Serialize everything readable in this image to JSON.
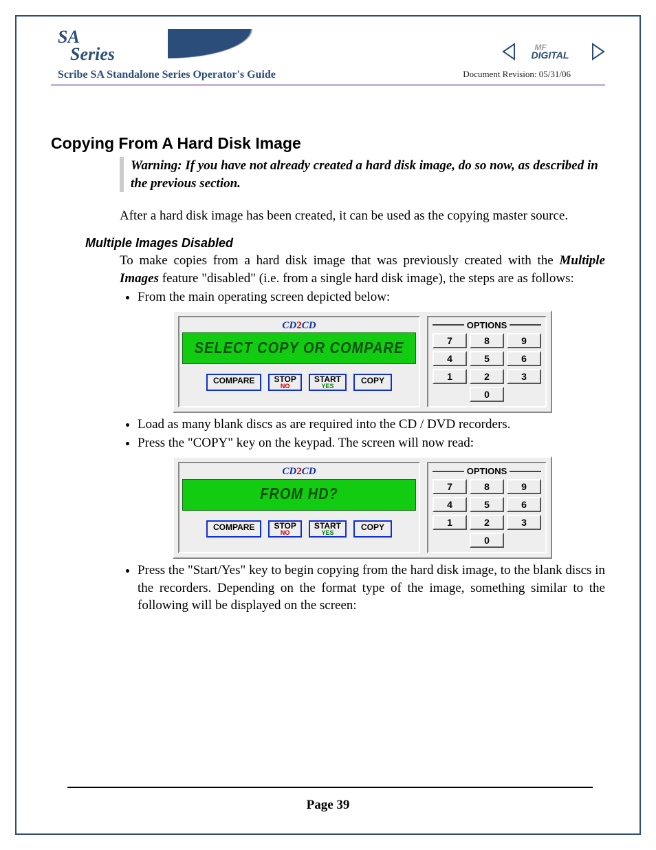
{
  "header": {
    "logo_line1": "SA",
    "logo_line2": "Series",
    "doc_title": "Scribe SA Standalone Series Operator's Guide",
    "doc_revision": "Document Revision: 05/31/06",
    "mf_logo_text": "MF DIGITAL"
  },
  "section": {
    "heading": "Copying From A Hard Disk Image",
    "warning": "Warning: If you have not already created a hard disk image, do so now, as described in the previous section.",
    "intro_para": "After a hard disk image has been created, it can be used as the copying master source.",
    "subheading": "Multiple Images Disabled",
    "sub_para_pre": "To make copies from a hard disk image that was previously created with the ",
    "sub_para_strong": "Multiple Images",
    "sub_para_post": " feature \"disabled\" (i.e. from a single hard disk image), the steps are as follows:",
    "bullet1": "From the main operating screen depicted below:",
    "bullet2": "Load as many blank discs as are required into the CD / DVD recorders.",
    "bullet3": "Press the \"COPY\" key on the keypad. The screen will now read:",
    "bullet4": "Press the \"Start/Yes\" key to begin copying from the hard disk image, to the blank discs in the recorders. Depending on the format type of the image, something similar to the following will be displayed on the screen:"
  },
  "panel": {
    "brand_cd": "CD",
    "brand_2": "2",
    "brand_cd2": "CD",
    "screen1_text": "SELECT COPY OR COMPARE",
    "screen2_text": "FROM HD?",
    "btn_compare": "COMPARE",
    "btn_stop": "STOP",
    "btn_stop_sub": "NO",
    "btn_start": "START",
    "btn_start_sub": "YES",
    "btn_copy": "COPY",
    "options_label": "OPTIONS",
    "keys": [
      "7",
      "8",
      "9",
      "4",
      "5",
      "6",
      "1",
      "2",
      "3",
      "0"
    ]
  },
  "footer": {
    "page_label": "Page 39"
  }
}
